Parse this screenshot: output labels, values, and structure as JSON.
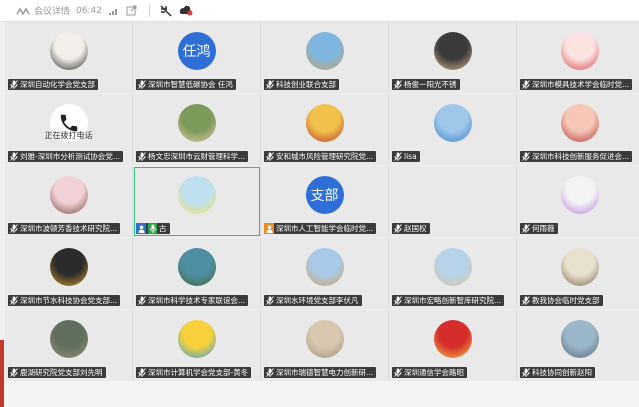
{
  "topbar": {
    "app_label": "会议详情",
    "time": "06:42"
  },
  "tiles": [
    {
      "name": "深圳自动化学会党支部",
      "avatar_icon": "photo-girl-bob-icon",
      "colors": [
        "#f3efe9",
        "#2a2a2a"
      ]
    },
    {
      "name": "深圳市智慧低碳协会 任鸿",
      "avatar_text": "任鸿"
    },
    {
      "name": "科技创业联合支部",
      "avatar_icon": "photo-sea-sky-icon",
      "colors": [
        "#7fb6e0",
        "#c9a165"
      ]
    },
    {
      "name": "杨俊一阳光不锈",
      "avatar_icon": "photo-gym-icon",
      "colors": [
        "#3a3a3a",
        "#d9b48a"
      ]
    },
    {
      "name": "深圳市模具技术学会临时党...",
      "avatar_icon": "photo-cartoon-girl-icon",
      "colors": [
        "#fde2e2",
        "#d64545"
      ]
    },
    {
      "name": "刘雅-深圳市分析测试协会党...",
      "avatar_icon": "phone-call-icon",
      "calling_text": "正在拨打电话"
    },
    {
      "name": "杨文忠深圳市云财管理科学...",
      "avatar_icon": "photo-man-icon",
      "colors": [
        "#7c9a5a",
        "#e6c9a4"
      ]
    },
    {
      "name": "安和城市风险管理研究院党...",
      "avatar_icon": "photo-flower-icon",
      "colors": [
        "#f0c24b",
        "#c0392b"
      ]
    },
    {
      "name": "lisa",
      "avatar_icon": "photo-bird-icon",
      "colors": [
        "#9ec7ea",
        "#3f82c7"
      ]
    },
    {
      "name": "深圳市科技创新服务促进会...",
      "avatar_icon": "photo-laughing-woman-icon",
      "colors": [
        "#f6c7b6",
        "#b23b3b"
      ]
    },
    {
      "name": "深圳市波顿芳香技术研究院...",
      "avatar_icon": "photo-woman-pink-icon",
      "colors": [
        "#f2d1d6",
        "#7a4b3c"
      ]
    },
    {
      "name": "古",
      "avatar_icon": "photo-baby-bottle-icon",
      "colors": [
        "#bfe0ef",
        "#f1e36a"
      ],
      "active": true
    },
    {
      "name": "深圳市人工智能学会临时党...",
      "avatar_text": "支部"
    },
    {
      "name": "赵国权",
      "avatar_icon": "",
      "colors": []
    },
    {
      "name": "何雨薇",
      "avatar_icon": "photo-anime-cat-icon",
      "colors": [
        "#f3f3f3",
        "#b77de0"
      ]
    },
    {
      "name": "深圳市节水科技协会党支部...",
      "avatar_icon": "photo-gold-gourd-icon",
      "colors": [
        "#2b2b2b",
        "#d99a2b"
      ]
    },
    {
      "name": "深圳市科学技术专家联谊会...",
      "avatar_icon": "photo-lake-icon",
      "colors": [
        "#4f8fa3",
        "#3e6b3a"
      ]
    },
    {
      "name": "深圳水环境党支部李伏凡",
      "avatar_icon": "photo-field-icon",
      "colors": [
        "#a9c9e8",
        "#d1a35b"
      ]
    },
    {
      "name": "深圳市宏略创新智库研究院...",
      "avatar_icon": "photo-beach-icon",
      "colors": [
        "#b7d3ea",
        "#d8c7a2"
      ]
    },
    {
      "name": "教我协会临时党支部",
      "avatar_icon": "photo-sketch-icon",
      "colors": [
        "#e9e1cf",
        "#7b6a55"
      ]
    },
    {
      "name": "鹿湖研究院党支部刘先明",
      "avatar_icon": "photo-road-icon",
      "colors": [
        "#5f6f5b",
        "#9c8f7a"
      ]
    },
    {
      "name": "深圳市计算机学会党支部-黄冬",
      "avatar_icon": "photo-emoji-icon",
      "colors": [
        "#f6d13b",
        "#3a9ad9"
      ]
    },
    {
      "name": "深圳市瑞德智慧电力创新研...",
      "avatar_icon": "photo-haze-icon",
      "colors": [
        "#d9c8b0",
        "#a58f78"
      ]
    },
    {
      "name": "深圳通信学会路昭",
      "avatar_icon": "photo-new-year-icon",
      "colors": [
        "#d62c2c",
        "#f4c542"
      ]
    },
    {
      "name": "科技协同创新赵阳",
      "avatar_icon": "photo-airplane-icon",
      "colors": [
        "#9cb6c9",
        "#5a6b78"
      ]
    }
  ]
}
